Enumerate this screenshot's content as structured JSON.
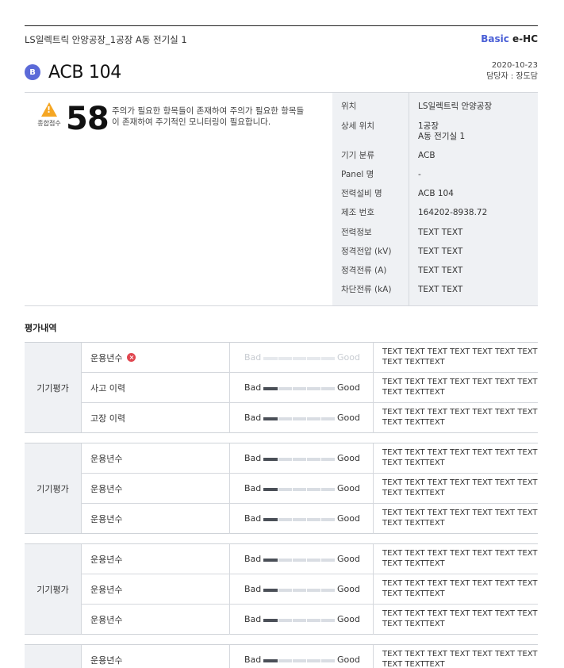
{
  "header": {
    "breadcrumb": "LS일렉트릭 안양공장_1공장 A동 전기실 1",
    "brand_primary": "Basic",
    "brand_secondary": "e-HC",
    "grade": "B",
    "title": "ACB 104",
    "date": "2020-10-23",
    "manager": "담당자 : 장도담"
  },
  "summary": {
    "score_label": "종합점수",
    "score": "58",
    "description": "주의가 필요한 항목들이 존재하여 주의가 필요한 항목들이 존재하여 주기적인 모니터링이 필요합니다.",
    "info": [
      {
        "label": "위치",
        "value": "LS일렉트릭 안양공장"
      },
      {
        "label": "상세 위치",
        "value": "1공장\nA동 전기실 1"
      },
      {
        "label": "기기 분류",
        "value": "ACB"
      },
      {
        "label": "Panel 명",
        "value": "-"
      },
      {
        "label": "전력설비 명",
        "value": "ACB 104"
      },
      {
        "label": "제조 번호",
        "value": "164202-8938.72"
      },
      {
        "label": "전력정보",
        "value": "TEXT TEXT"
      },
      {
        "label": "정격전압 (kV)",
        "value": "TEXT TEXT"
      },
      {
        "label": "정격전류 (A)",
        "value": "TEXT TEXT"
      },
      {
        "label": "차단전류 (kA)",
        "value": "TEXT TEXT"
      }
    ]
  },
  "evaluation": {
    "title": "평가내역",
    "bad_label": "Bad",
    "good_label": "Good",
    "groups": [
      {
        "label": "기기평가",
        "rows": [
          {
            "item": "운용년수",
            "error": true,
            "level": 0,
            "note": "TEXT TEXT TEXT TEXT TEXT TEXT TEXT TEXT TEXTTEXT"
          },
          {
            "item": "사고 이력",
            "error": false,
            "level": 0.2,
            "note": "TEXT TEXT TEXT TEXT TEXT TEXT TEXT TEXT TEXTTEXT"
          },
          {
            "item": "고장 이력",
            "error": false,
            "level": 0.2,
            "note": "TEXT TEXT TEXT TEXT TEXT TEXT TEXT TEXT TEXTTEXT"
          }
        ]
      },
      {
        "label": "기기평가",
        "rows": [
          {
            "item": "운용년수",
            "error": false,
            "level": 0.2,
            "note": "TEXT TEXT TEXT TEXT TEXT TEXT TEXT TEXT TEXTTEXT"
          },
          {
            "item": "운용년수",
            "error": false,
            "level": 0.2,
            "note": "TEXT TEXT TEXT TEXT TEXT TEXT TEXT TEXT TEXTTEXT"
          },
          {
            "item": "운용년수",
            "error": false,
            "level": 0.2,
            "note": "TEXT TEXT TEXT TEXT TEXT TEXT TEXT TEXT TEXTTEXT"
          }
        ]
      },
      {
        "label": "기기평가",
        "rows": [
          {
            "item": "운용년수",
            "error": false,
            "level": 0.2,
            "note": "TEXT TEXT TEXT TEXT TEXT TEXT TEXT TEXT TEXTTEXT"
          },
          {
            "item": "운용년수",
            "error": false,
            "level": 0.2,
            "note": "TEXT TEXT TEXT TEXT TEXT TEXT TEXT TEXT TEXTTEXT"
          },
          {
            "item": "운용년수",
            "error": false,
            "level": 0.2,
            "note": "TEXT TEXT TEXT TEXT TEXT TEXT TEXT TEXT TEXTTEXT"
          }
        ]
      },
      {
        "label": "",
        "rows": [
          {
            "item": "운용년수",
            "error": false,
            "level": 0.2,
            "note": "TEXT TEXT TEXT TEXT TEXT TEXT TEXT TEXT TEXTTEXT"
          }
        ]
      }
    ]
  }
}
